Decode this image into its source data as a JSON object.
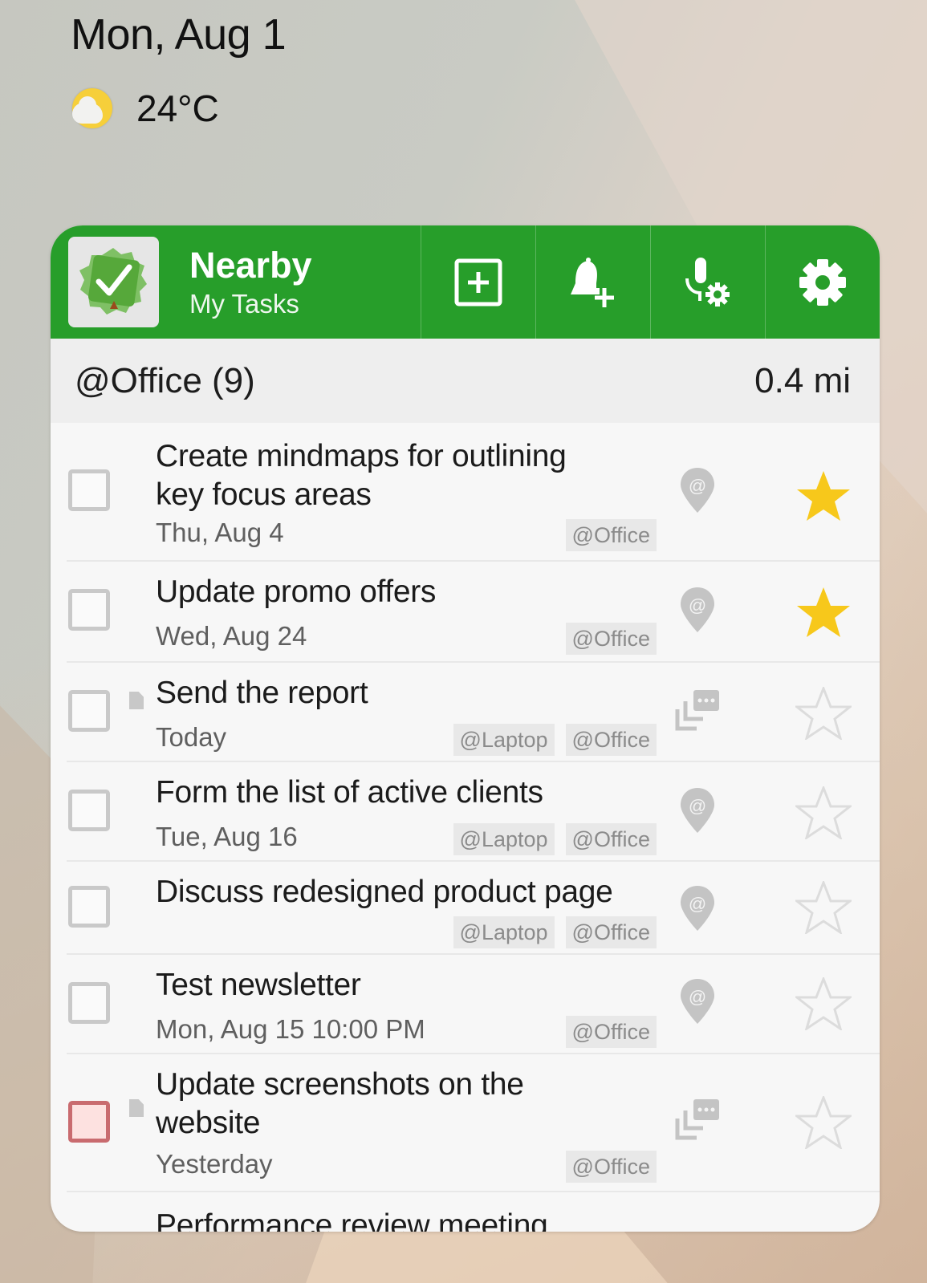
{
  "wallpaper": {
    "date": "Mon, Aug 1",
    "weather": {
      "icon": "partly-cloudy-icon",
      "temperature": "24°C"
    }
  },
  "widget": {
    "header": {
      "title": "Nearby",
      "subtitle": "My Tasks",
      "logo_icon": "tree-check-logo-icon",
      "buttons": [
        {
          "name": "add-task-button",
          "icon": "plus-square-icon"
        },
        {
          "name": "add-reminder-button",
          "icon": "bell-plus-icon"
        },
        {
          "name": "voice-settings-button",
          "icon": "mic-gear-icon"
        },
        {
          "name": "settings-button",
          "icon": "gear-icon"
        }
      ],
      "brand_color": "#279e2a"
    },
    "group": {
      "label": "@Office (9)",
      "distance": "0.4 mi"
    },
    "tasks": [
      {
        "title": "Create mindmaps for outlining key focus areas",
        "date": "Thu, Aug 4",
        "tags": [
          "@Office"
        ],
        "type_icon": "location-at-icon",
        "starred": true,
        "has_note": false,
        "overdue": false
      },
      {
        "title": "Update promo offers",
        "date": "Wed, Aug 24",
        "tags": [
          "@Office"
        ],
        "type_icon": "location-at-icon",
        "starred": true,
        "has_note": false,
        "overdue": false
      },
      {
        "title": "Send the report",
        "date": "Today",
        "tags": [
          "@Laptop",
          "@Office"
        ],
        "type_icon": "subtasks-icon",
        "starred": false,
        "has_note": true,
        "overdue": false
      },
      {
        "title": "Form the list of active clients",
        "date": "Tue, Aug 16",
        "tags": [
          "@Laptop",
          "@Office"
        ],
        "type_icon": "location-at-icon",
        "starred": false,
        "has_note": false,
        "overdue": false
      },
      {
        "title": "Discuss redesigned product page",
        "date": "",
        "tags": [
          "@Laptop",
          "@Office"
        ],
        "type_icon": "location-at-icon",
        "starred": false,
        "has_note": false,
        "overdue": false
      },
      {
        "title": "Test newsletter",
        "date": "Mon, Aug 15 10:00 PM",
        "tags": [
          "@Office"
        ],
        "type_icon": "location-at-icon",
        "starred": false,
        "has_note": false,
        "overdue": false
      },
      {
        "title": "Update screenshots on the website",
        "date": "Yesterday",
        "tags": [
          "@Office"
        ],
        "type_icon": "subtasks-icon",
        "starred": false,
        "has_note": true,
        "overdue": true
      },
      {
        "title": "Performance review meeting",
        "date": "",
        "tags": [],
        "type_icon": "",
        "starred": false,
        "has_note": false,
        "overdue": false
      }
    ],
    "colors": {
      "star": "#f7c81b",
      "icon_gray": "#c4c4c4",
      "overdue_border": "#c96b6f",
      "overdue_fill": "#fde1e0"
    }
  }
}
